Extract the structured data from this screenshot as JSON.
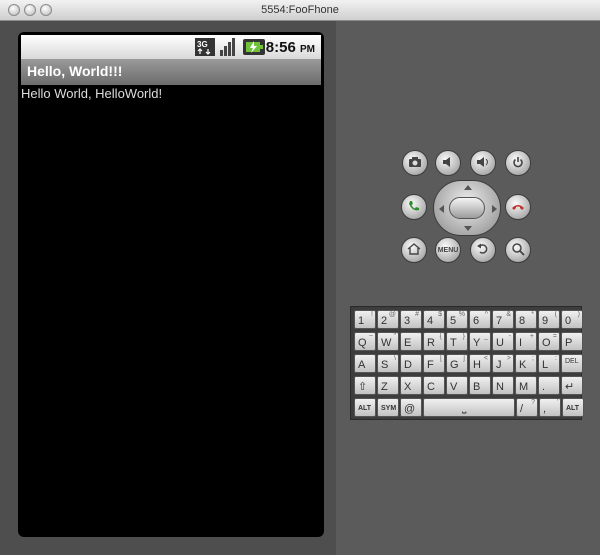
{
  "window": {
    "title": "5554:FooFhone"
  },
  "statusbar": {
    "network": "3G",
    "time": "8:56",
    "ampm": "PM"
  },
  "app": {
    "title": "Hello, World!!!",
    "content": "Hello World, HelloWorld!"
  },
  "controls": {
    "menu_label": "MENU"
  },
  "keyboard": {
    "rows": [
      [
        {
          "m": "1",
          "a": "!"
        },
        {
          "m": "2",
          "a": "@"
        },
        {
          "m": "3",
          "a": "#"
        },
        {
          "m": "4",
          "a": "$"
        },
        {
          "m": "5",
          "a": "%"
        },
        {
          "m": "6",
          "a": "^"
        },
        {
          "m": "7",
          "a": "&"
        },
        {
          "m": "8",
          "a": "*"
        },
        {
          "m": "9",
          "a": "("
        },
        {
          "m": "0",
          "a": ")"
        }
      ],
      [
        {
          "m": "Q",
          "a": "~"
        },
        {
          "m": "W",
          "a": "\""
        },
        {
          "m": "E",
          "a": "`"
        },
        {
          "m": "R",
          "a": "{"
        },
        {
          "m": "T",
          "a": "}"
        },
        {
          "m": "Y",
          "a": "_"
        },
        {
          "m": "U",
          "a": "-"
        },
        {
          "m": "I",
          "a": "+"
        },
        {
          "m": "O",
          "a": "="
        },
        {
          "m": "P",
          "a": ""
        }
      ],
      [
        {
          "m": "A",
          "a": ""
        },
        {
          "m": "S",
          "a": "\\"
        },
        {
          "m": "D",
          "a": ""
        },
        {
          "m": "F",
          "a": "["
        },
        {
          "m": "G",
          "a": "]"
        },
        {
          "m": "H",
          "a": "<"
        },
        {
          "m": "J",
          "a": ">"
        },
        {
          "m": "K",
          "a": ";"
        },
        {
          "m": "L",
          "a": ":"
        },
        {
          "m": "DEL",
          "a": ""
        }
      ],
      [
        {
          "m": "⇧",
          "a": ""
        },
        {
          "m": "Z",
          "a": ""
        },
        {
          "m": "X",
          "a": ""
        },
        {
          "m": "C",
          "a": ""
        },
        {
          "m": "V",
          "a": ""
        },
        {
          "m": "B",
          "a": ""
        },
        {
          "m": "N",
          "a": ""
        },
        {
          "m": "M",
          "a": ""
        },
        {
          "m": ".",
          "a": ""
        },
        {
          "m": "↵",
          "a": ""
        }
      ]
    ],
    "bottom": {
      "alt_left": "ALT",
      "sym": "SYM",
      "at": "@",
      "space": "⎵",
      "slash": "/",
      "slash_alt": "?",
      "comma": ",",
      "comma_alt": "'",
      "alt_right": "ALT"
    }
  }
}
